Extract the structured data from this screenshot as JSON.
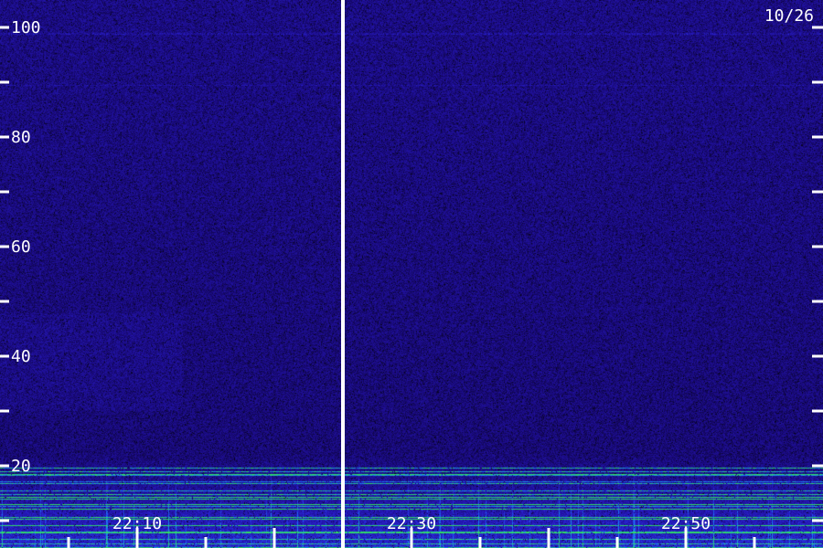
{
  "chart_data": {
    "type": "heatmap",
    "title": "",
    "xlabel": "",
    "ylabel": "",
    "date_label": "10/26",
    "y_ticks": [
      100,
      80,
      60,
      40,
      20
    ],
    "y_minor_ticks": [
      90,
      70,
      50,
      30,
      10
    ],
    "ylim": [
      0,
      100
    ],
    "x_tick_labels": [
      "22:10",
      "22:30",
      "22:50"
    ],
    "xlim": [
      "22:00",
      "23:00"
    ],
    "divider_time": "22:25",
    "minor_tick_interval_min": 5,
    "colormap": [
      "#000000",
      "#1a0a80",
      "#2a20d0",
      "#1a80ff",
      "#30e060"
    ],
    "background": "#000000",
    "line_color": "#ffffff",
    "grid": false
  }
}
